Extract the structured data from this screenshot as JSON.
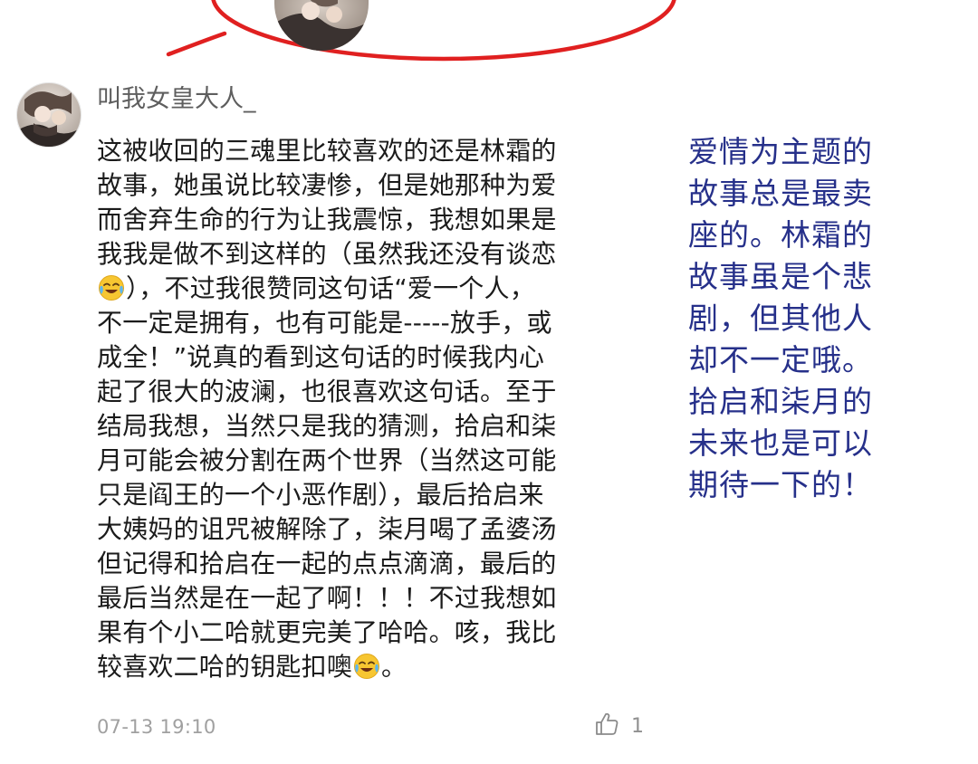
{
  "comment": {
    "username": "叫我女皇大人_",
    "body_lines": [
      "这被收回的三魂里比较喜欢的还是林霜的",
      "故事，她虽说比较凄惨，但是她那种为爱",
      "而舍弃生命的行为让我震惊，我想如果是",
      "我我是做不到这样的（虽然我还没有谈恋",
      "），不过我很赞同这句话“爱一个人，",
      "不一定是拥有，也有可能是-----放手，或",
      "成全！”说真的看到这句话的时候我内心",
      "起了很大的波澜，也很喜欢这句话。至于",
      "结局我想，当然只是我的猜测，拾启和柒",
      "月可能会被分割在两个世界（当然这可能",
      "只是阎王的一个小恶作剧），最后拾启来",
      "大姨妈的诅咒被解除了，柒月喝了孟婆汤",
      "但记得和拾启在一起的点点滴滴，最后的",
      "最后当然是在一起了啊！！！不过我想如",
      "果有个小二哈就更完美了哈哈。咳，我比",
      "较喜欢二哈的钥匙扣噢",
      "。"
    ],
    "emoji_icon": "face-with-tears-of-joy-icon",
    "timestamp": "07-13 19:10",
    "like_count": "1"
  },
  "annotation": {
    "lines": [
      "爱情为主题的",
      "故事总是最卖",
      "座的。林霜的",
      "故事虽是个悲",
      "剧，但其他人",
      "却不一定哦。",
      "拾启和柒月的",
      "未来也是可以",
      "期待一下的！"
    ]
  },
  "colors": {
    "callout_ellipse": "#e02020",
    "annotation_text": "#26308a",
    "username_text": "#5e5e5e",
    "body_text": "#1b1b1b",
    "meta_text": "#a0a0a0"
  }
}
